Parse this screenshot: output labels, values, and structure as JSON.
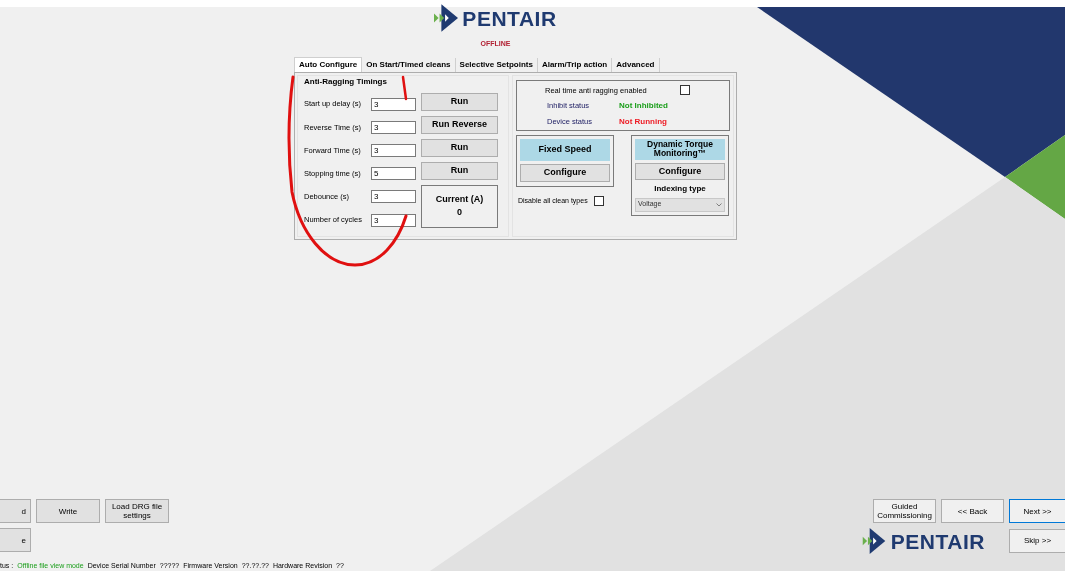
{
  "header": {
    "logo_text": "PENTAIR",
    "connection_status": "OFFLINE"
  },
  "tabs": [
    {
      "label": "Auto Configure",
      "selected": true
    },
    {
      "label": "On Start/Timed cleans",
      "selected": false
    },
    {
      "label": "Selective Setpoints",
      "selected": false
    },
    {
      "label": "Alarm/Trip action",
      "selected": false
    },
    {
      "label": "Advanced",
      "selected": false
    }
  ],
  "anti_ragging": {
    "title": "Anti-Ragging Timings",
    "rows": [
      {
        "label": "Start up delay (s)",
        "value": "3",
        "button": "Run"
      },
      {
        "label": "Reverse Time (s)",
        "value": "3",
        "button": "Run Reverse"
      },
      {
        "label": "Forward Time (s)",
        "value": "3",
        "button": "Run"
      },
      {
        "label": "Stopping time (s)",
        "value": "5",
        "button": "Run"
      },
      {
        "label": "Debounce (s)",
        "value": "3"
      },
      {
        "label": "Number of cycles",
        "value": "3"
      }
    ],
    "current": {
      "label": "Current (A)",
      "value": "0"
    }
  },
  "status_panel": {
    "realtime": {
      "label": "Real time anti ragging enabled",
      "checked": false
    },
    "rows": [
      {
        "label": "Inhibit status",
        "value": "Not Inhibited",
        "color": "#1a9e1a"
      },
      {
        "label": "Device status",
        "value": "Not Running",
        "color": "#ee1c25"
      }
    ]
  },
  "modes": [
    {
      "title": "Fixed Speed",
      "button": "Configure"
    },
    {
      "title": "Dynamic Torque Monitoring™",
      "button": "Configure",
      "indexing": {
        "label": "Indexing type",
        "value": "Voltage"
      }
    }
  ],
  "disable_clean": {
    "label": "Disable all clean types",
    "checked": false
  },
  "left_buttons": [
    [
      "d",
      "Write",
      "Load DRG file settings"
    ],
    [
      "e"
    ]
  ],
  "nav_buttons": [
    {
      "label": "Guided Commissioning",
      "focused": false
    },
    {
      "label": "<< Back",
      "focused": false
    },
    {
      "label": "Next >>",
      "focused": true
    },
    {
      "label": "Skip >>",
      "focused": false
    }
  ],
  "footer_logo_text": "PENTAIR",
  "status_bar": [
    {
      "label": "tus :",
      "value": "Offline file view mode",
      "highlight": true
    },
    {
      "label": "Device Serial Number",
      "value": "?????",
      "highlight": false
    },
    {
      "label": "Firmware Version",
      "value": "??.??.??",
      "highlight": false
    },
    {
      "label": "Hardware Revision",
      "value": "??",
      "highlight": false
    }
  ]
}
